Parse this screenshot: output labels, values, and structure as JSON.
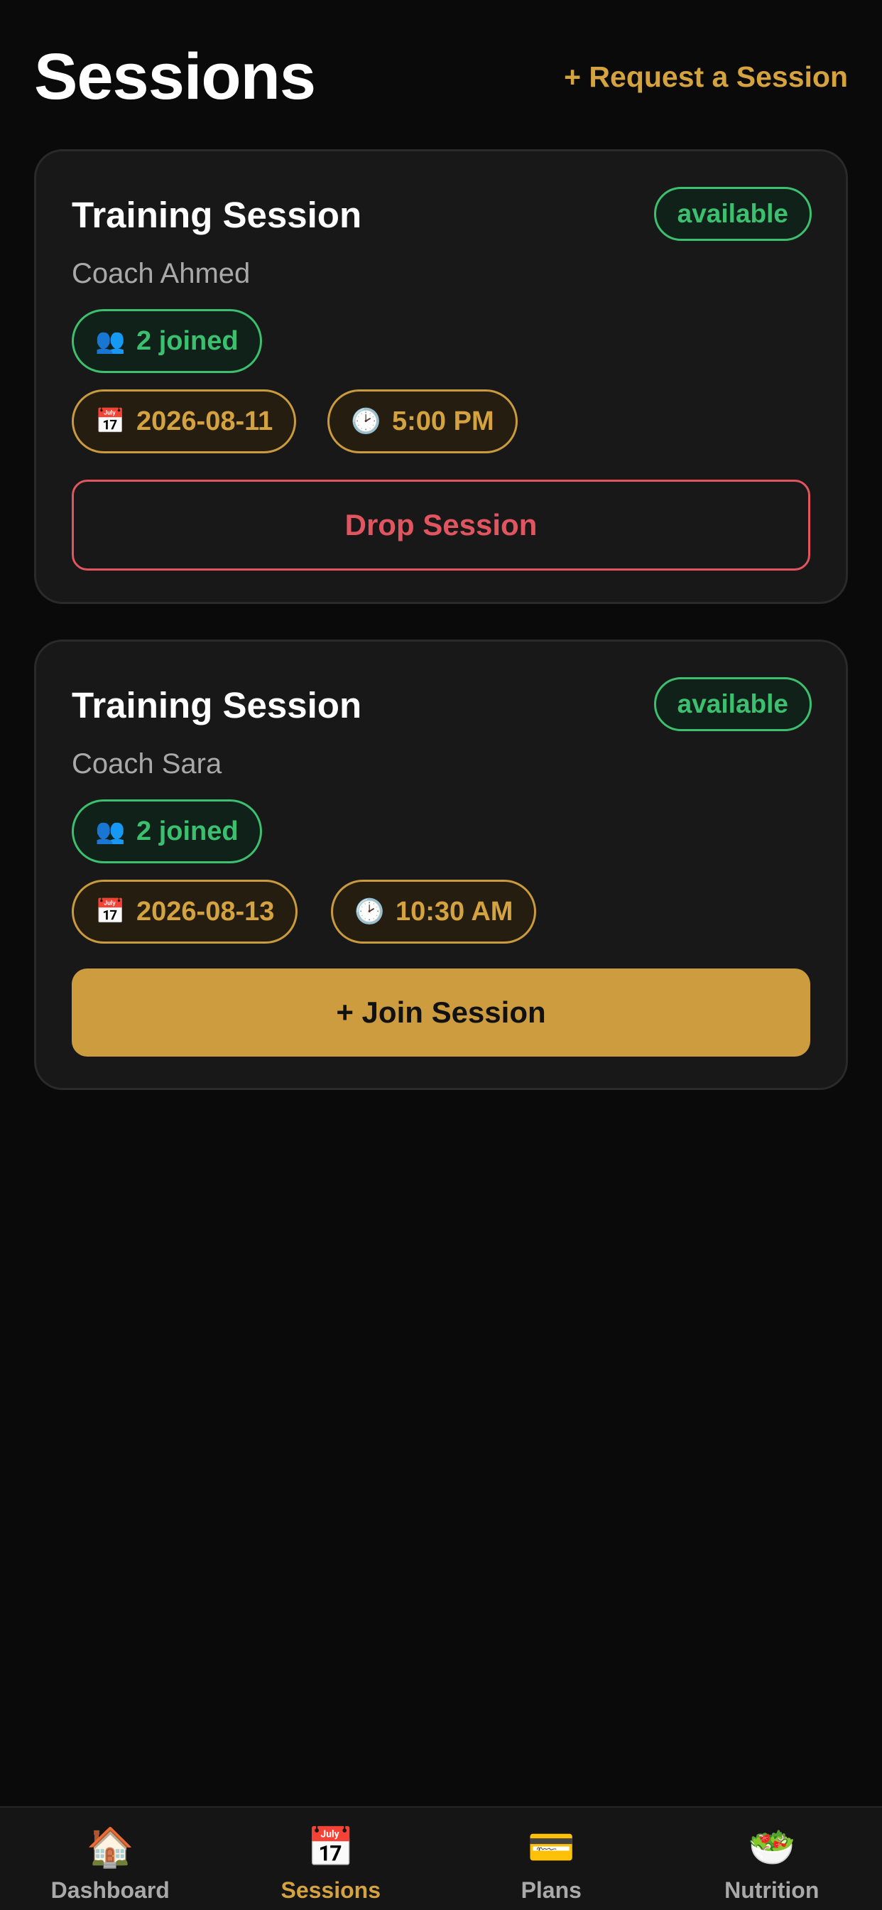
{
  "header": {
    "title": "Sessions",
    "request_label": "+ Request a Session"
  },
  "sessions": [
    {
      "title": "Training Session",
      "status": "available",
      "coach": "Coach Ahmed",
      "joined": "2 joined",
      "joined_icon": "👥",
      "date": "2026-08-11",
      "date_icon": "📅",
      "time": "5:00 PM",
      "time_icon": "🕑",
      "action_label": "Drop Session"
    },
    {
      "title": "Training Session",
      "status": "available",
      "coach": "Coach Sara",
      "joined": "2 joined",
      "joined_icon": "👥",
      "date": "2026-08-13",
      "date_icon": "📅",
      "time": "10:30 AM",
      "time_icon": "🕑",
      "action_label": "+ Join Session"
    }
  ],
  "nav": {
    "items": [
      {
        "label": "Dashboard",
        "icon": "🏠",
        "icon_name": "house-icon"
      },
      {
        "label": "Sessions",
        "icon": "📅",
        "icon_name": "calendar-icon",
        "active": true
      },
      {
        "label": "Plans",
        "icon": "💳",
        "icon_name": "card-icon"
      },
      {
        "label": "Nutrition",
        "icon": "🥗",
        "icon_name": "salad-icon"
      }
    ]
  },
  "colors": {
    "background": "#0a0a0a",
    "card": "#181818",
    "accent_gold": "#d4a23f",
    "status_green": "#3cbf6e",
    "danger_red": "#e05560"
  }
}
